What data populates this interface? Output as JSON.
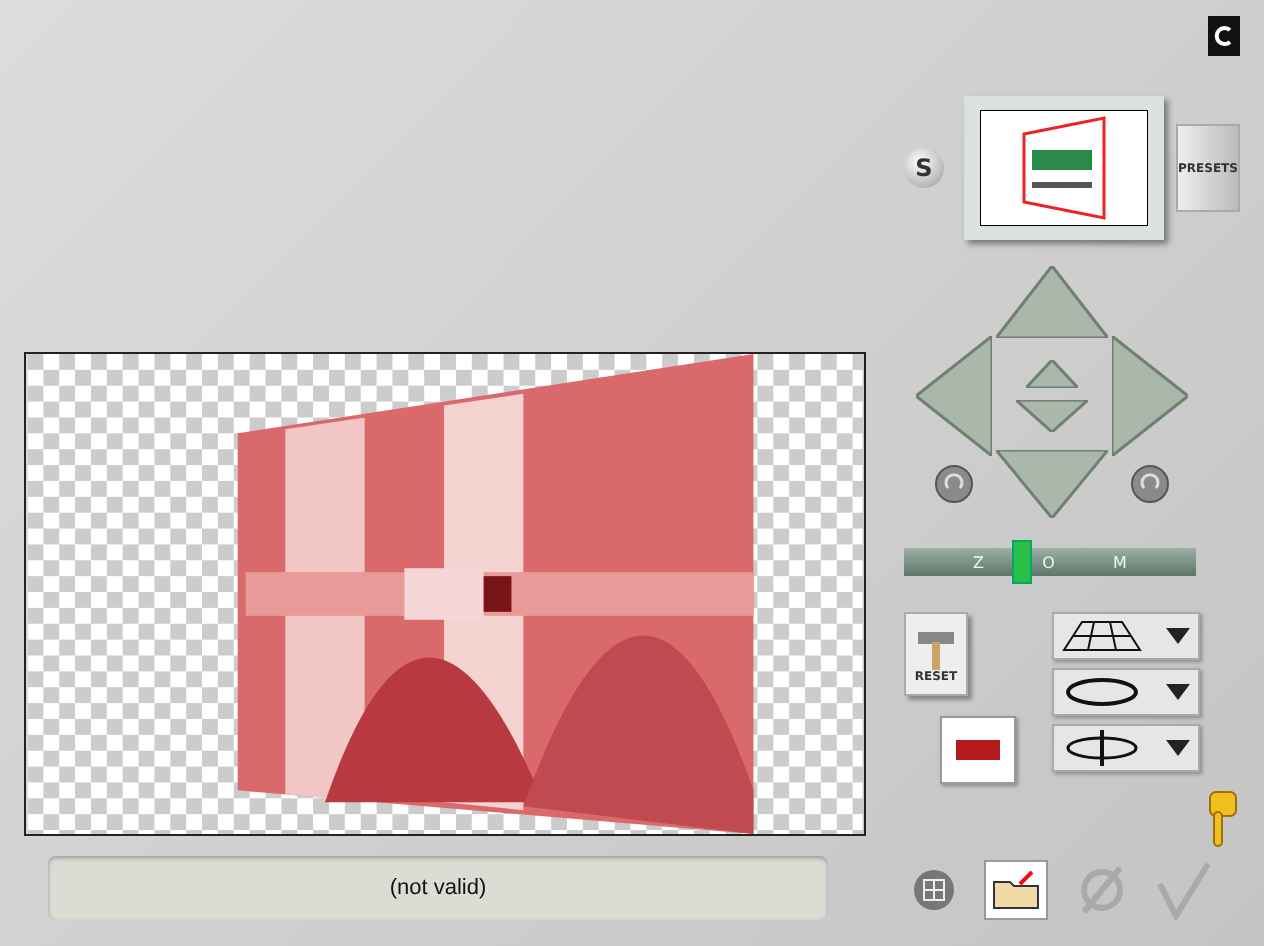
{
  "s_button": "S",
  "presets_button": "PRESETS",
  "zoom": {
    "letters": [
      "Z",
      "O",
      "M"
    ],
    "level": 0.4
  },
  "reset_button": "RESET",
  "status": "(not valid)"
}
